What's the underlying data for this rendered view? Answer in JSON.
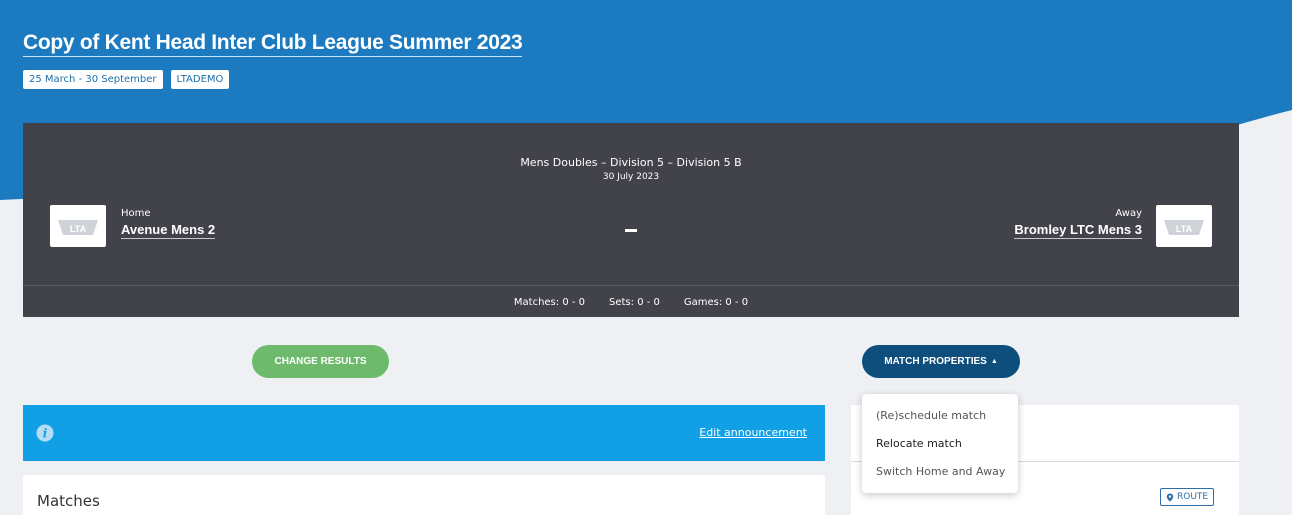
{
  "league": {
    "title": "Copy of Kent Head Inter Club League Summer 2023",
    "date_range": "25 March - 30 September",
    "org_code": "LTADEMO"
  },
  "match": {
    "competition": "Mens Doubles – Division 5 – Division 5 B",
    "date": "30 July 2023",
    "home": {
      "label": "Home",
      "name": "Avenue Mens 2",
      "logo": "LTA"
    },
    "away": {
      "label": "Away",
      "name": "Bromley LTC Mens 3",
      "logo": "LTA"
    },
    "stats": {
      "matches": "Matches: 0 - 0",
      "sets": "Sets: 0 - 0",
      "games": "Games: 0 - 0"
    }
  },
  "actions": {
    "change_results": "CHANGE RESULTS",
    "match_properties": "MATCH PROPERTIES"
  },
  "menu": {
    "items": [
      "(Re)schedule match",
      "Relocate match",
      "Switch Home and Away"
    ]
  },
  "announcement": {
    "edit_label": "Edit announcement",
    "icon": "info-icon"
  },
  "matches_section": {
    "title": "Matches"
  },
  "venue": {
    "route_label": "ROUTE",
    "icon": "location-pin-icon"
  },
  "colors": {
    "brand_blue": "#1b7ac0",
    "panel_dark": "#42424b",
    "green": "#6dba6c",
    "navy": "#0e4e7d",
    "announce": "#11a0e5"
  }
}
